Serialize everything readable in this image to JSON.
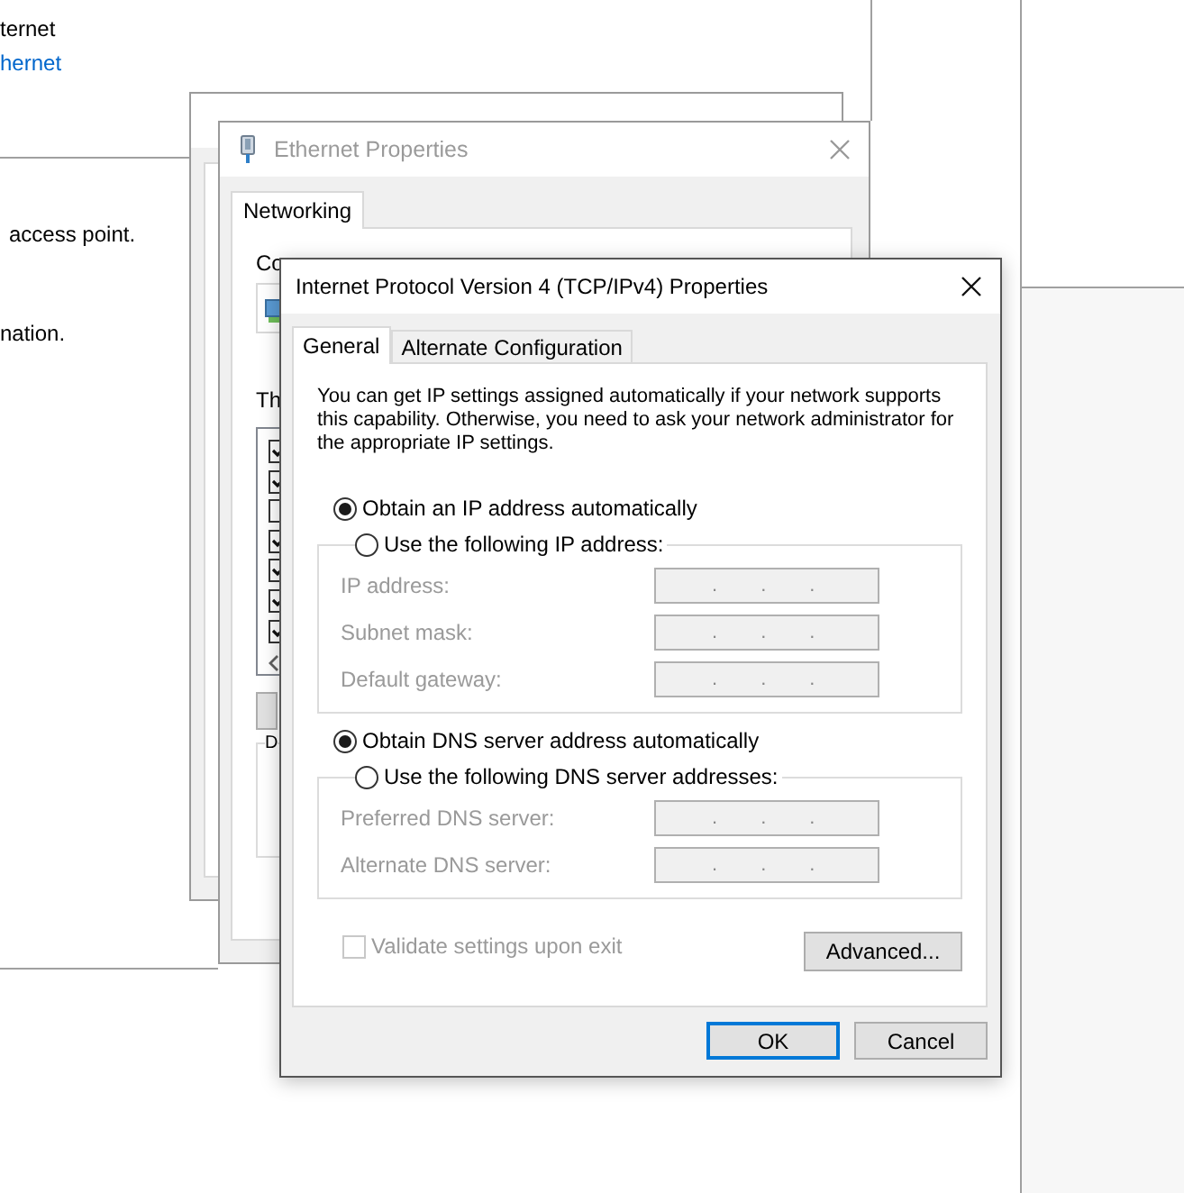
{
  "background": {
    "texts": [
      {
        "kind": "text",
        "text": "ternet"
      },
      {
        "kind": "link",
        "text": "hernet"
      },
      {
        "kind": "text",
        "text": "access point."
      },
      {
        "kind": "text",
        "text": "nation."
      }
    ]
  },
  "properties_window": {
    "title": "Ethernet Properties",
    "active": false,
    "tabs": [
      {
        "label": "Networking",
        "selected": true
      }
    ],
    "connect_label": "Co",
    "items_label": "Th",
    "items": [
      {
        "checked": true
      },
      {
        "checked": true
      },
      {
        "checked": false
      },
      {
        "checked": true
      },
      {
        "checked": true
      },
      {
        "checked": true
      },
      {
        "checked": true
      }
    ],
    "description_label": "D"
  },
  "dialog": {
    "title": "Internet Protocol Version 4 (TCP/IPv4) Properties",
    "active": true,
    "tabs": [
      {
        "label": "General",
        "selected": true
      },
      {
        "label": "Alternate Configuration",
        "selected": false
      }
    ],
    "intro": "You can get IP settings assigned automatically if your network supports this capability. Otherwise, you need to ask your network administrator for the appropriate IP settings.",
    "ip_options": [
      {
        "label": "Obtain an IP address automatically",
        "selected": true
      },
      {
        "label": "Use the following IP address:",
        "selected": false
      }
    ],
    "ip_fields": [
      {
        "label": "IP address:",
        "disabled": true,
        "separators": [
          ".",
          ".",
          "."
        ]
      },
      {
        "label": "Subnet mask:",
        "disabled": true,
        "separators": [
          ".",
          ".",
          "."
        ]
      },
      {
        "label": "Default gateway:",
        "disabled": true,
        "separators": [
          ".",
          ".",
          "."
        ]
      }
    ],
    "dns_options": [
      {
        "label": "Obtain DNS server address automatically",
        "selected": true
      },
      {
        "label": "Use the following DNS server addresses:",
        "selected": false
      }
    ],
    "dns_fields": [
      {
        "label": "Preferred DNS server:",
        "disabled": true,
        "separators": [
          ".",
          ".",
          "."
        ]
      },
      {
        "label": "Alternate DNS server:",
        "disabled": true,
        "separators": [
          ".",
          ".",
          "."
        ]
      }
    ],
    "validate": {
      "label": "Validate settings upon exit",
      "checked": false,
      "disabled": true
    },
    "advanced_button": "Advanced...",
    "buttons": [
      {
        "label": "OK",
        "default": true
      },
      {
        "label": "Cancel",
        "default": false
      }
    ]
  }
}
